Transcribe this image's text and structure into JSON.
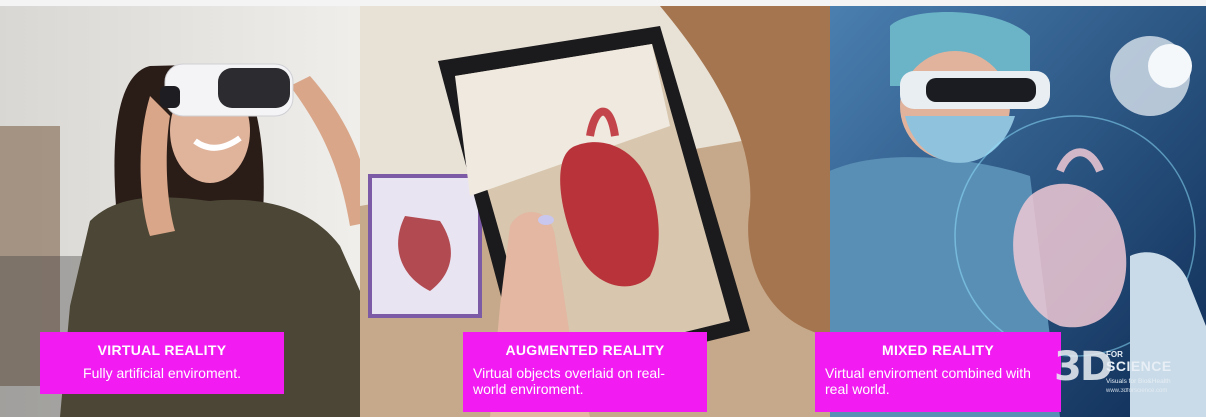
{
  "panels": [
    {
      "title": "VIRTUAL REALITY",
      "description": "Fully artificial enviroment."
    },
    {
      "title": "AUGMENTED REALITY",
      "description": "Virtual objects overlaid on real-world enviroment."
    },
    {
      "title": "MIXED REALITY",
      "description": "Virtual enviroment combined with real world."
    }
  ],
  "logo": {
    "mark": "3D",
    "for": "FOR",
    "science": "SCIENCE",
    "tagline": "Visuals for Bio&Health",
    "url": "www.3dforscience.com"
  },
  "colors": {
    "caption_bg": "#f21cf2",
    "caption_text": "#ffffff"
  },
  "icons": [
    "vr-headset-icon",
    "tablet-icon",
    "heart-hologram-icon"
  ]
}
